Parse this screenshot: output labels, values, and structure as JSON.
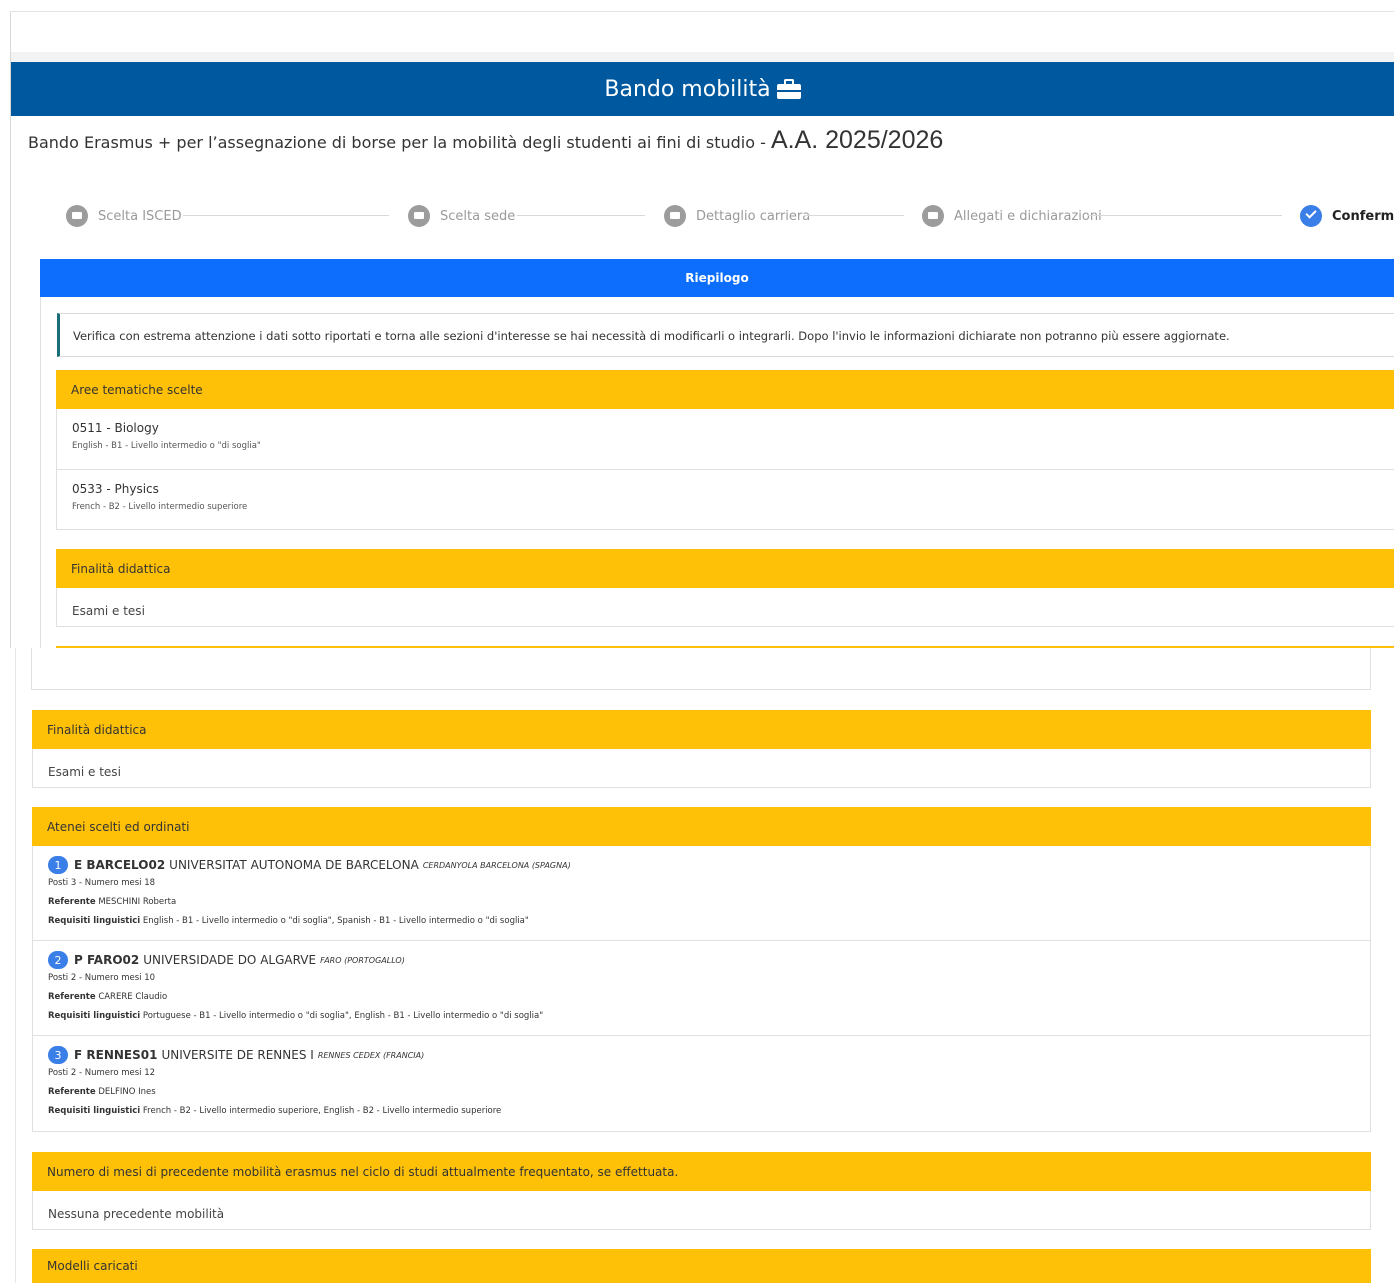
{
  "header": {
    "title": "Bando mobilità",
    "title_icon": "briefcase-icon"
  },
  "subtitle": {
    "lead": "Bando Erasmus + per l’assegnazione di borse per la mobilità degli studenti ai fini di studio - ",
    "year": "A.A. 2025/2026"
  },
  "stepper": {
    "steps": [
      {
        "label": "Scelta ISCED",
        "icon": "briefcase-icon",
        "state": "inactive"
      },
      {
        "label": "Scelta sede",
        "icon": "list-icon",
        "state": "inactive"
      },
      {
        "label": "Dettaglio carriera",
        "icon": "book-icon",
        "state": "inactive"
      },
      {
        "label": "Allegati e dichiarazioni",
        "icon": "paperclip-icon",
        "state": "inactive"
      },
      {
        "label": "Conferma",
        "icon": "check-icon",
        "state": "active"
      }
    ],
    "accent_color": "#3a7ee8"
  },
  "summary": {
    "title": "Riepilogo",
    "notice": "Verifica con estrema attenzione i dati sotto riportati e torna alle sezioni d'interesse se hai necessità di modificarli o integrarli. Dopo l'invio le informazioni dichiarate non potranno più essere aggiornate.",
    "colors": {
      "header": "#0d6efd",
      "panel": "#ffc107",
      "title_bar": "#00599e"
    }
  },
  "areas": {
    "title": "Aree tematiche scelte",
    "items": [
      {
        "name": "0511 - Biology",
        "language": "English - B1 - Livello intermedio o \"di soglia\""
      },
      {
        "name": "0533 - Physics",
        "language": "French - B2 - Livello intermedio superiore"
      }
    ]
  },
  "purpose": {
    "title": "Finalità didattica",
    "value": "Esami e tesi"
  },
  "universities": {
    "title": "Atenei scelti ed ordinati",
    "posti_label": "Posti",
    "mesi_label": "Numero mesi",
    "referente_label": "Referente",
    "requisiti_label": "Requisiti linguistici",
    "items": [
      {
        "rank": "1",
        "code": "E BARCELO02",
        "name": "UNIVERSITAT AUTONOMA DE BARCELONA",
        "city": "CERDANYOLA BARCELONA (SPAGNA)",
        "posti": "3",
        "mesi": "18",
        "referente": "MESCHINI Roberta",
        "requisiti": "English - B1 - Livello intermedio o \"di soglia\", Spanish - B1 - Livello intermedio o \"di soglia\""
      },
      {
        "rank": "2",
        "code": "P FARO02",
        "name": "UNIVERSIDADE DO ALGARVE",
        "city": "FARO (PORTOGALLO)",
        "posti": "2",
        "mesi": "10",
        "referente": "CARERE Claudio",
        "requisiti": "Portuguese - B1 - Livello intermedio o \"di soglia\", English - B1 - Livello intermedio o \"di soglia\""
      },
      {
        "rank": "3",
        "code": "F RENNES01",
        "name": "UNIVERSITE DE RENNES I",
        "city": "RENNES CEDEX (FRANCIA)",
        "posti": "2",
        "mesi": "12",
        "referente": "DELFINO Ines",
        "requisiti": "French - B2 - Livello intermedio superiore, English - B2 - Livello intermedio superiore"
      }
    ]
  },
  "previous_mobility": {
    "title": "Numero di mesi di precedente mobilità erasmus nel ciclo di studi attualmente frequentato, se effettuata.",
    "value": "Nessuna precedente mobilità"
  },
  "models": {
    "title": "Modelli caricati"
  }
}
